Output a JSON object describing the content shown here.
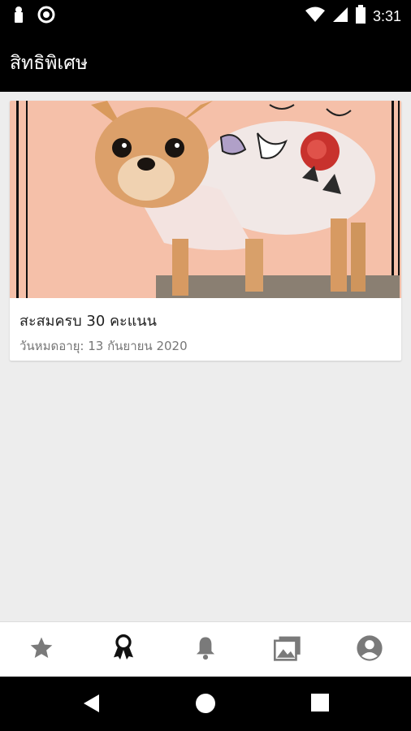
{
  "status_bar": {
    "time": "3:31",
    "icons": [
      "notification-icon",
      "sync-icon",
      "wifi-icon",
      "signal-icon",
      "battery-icon"
    ]
  },
  "app_bar": {
    "title": "สิทธิพิเศษ"
  },
  "privileges": [
    {
      "title": "สะสมครบ 30 คะแนน",
      "expiry": "วันหมดอายุ: 13 กันยายน 2020",
      "image": "chihuahua-in-floral-outfit"
    }
  ],
  "bottom_nav": {
    "items": [
      {
        "icon": "star-icon",
        "active": false
      },
      {
        "icon": "award-ribbon-icon",
        "active": true
      },
      {
        "icon": "bell-icon",
        "active": false
      },
      {
        "icon": "gallery-icon",
        "active": false
      },
      {
        "icon": "account-circle-icon",
        "active": false
      }
    ]
  },
  "colors": {
    "bar": "#000000",
    "background": "#ededed",
    "nav_inactive": "#7a7a7a",
    "nav_active": "#111111"
  }
}
